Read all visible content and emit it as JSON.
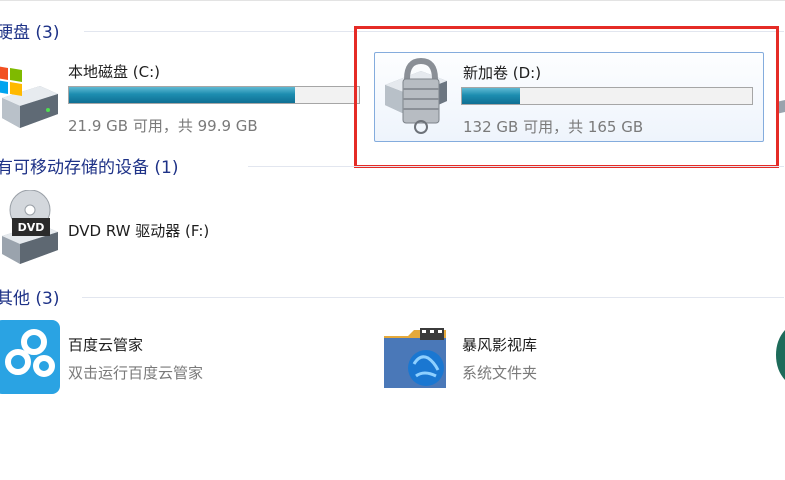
{
  "groups": {
    "hard_disks": {
      "label": "硬盘 (3)"
    },
    "removable": {
      "label": "有可移动存储的设备 (1)"
    },
    "other": {
      "label": "其他 (3)"
    }
  },
  "drives": [
    {
      "name": "本地磁盘 (C:)",
      "space": "21.9 GB 可用，共 99.9 GB",
      "used_fraction": 0.78,
      "icon": "windows-drive-icon"
    },
    {
      "name": "新加卷 (D:)",
      "space": "132 GB 可用，共 165 GB",
      "used_fraction": 0.2,
      "icon": "locked-drive-icon",
      "selected": true
    }
  ],
  "removable_devices": [
    {
      "name": "DVD RW 驱动器 (F:)",
      "icon": "dvd-drive-icon",
      "icon_text": "DVD"
    }
  ],
  "others": [
    {
      "name": "百度云管家",
      "sub": "双击运行百度云管家",
      "icon": "baidu-cloud-icon"
    },
    {
      "name": "暴风影视库",
      "sub": "系统文件夹",
      "icon": "storm-video-library-icon"
    }
  ],
  "colors": {
    "group_header": "#1e3287",
    "bar_fill": "#1d8db0",
    "highlight_box": "#e52b26",
    "selection_border": "#84acdd"
  }
}
